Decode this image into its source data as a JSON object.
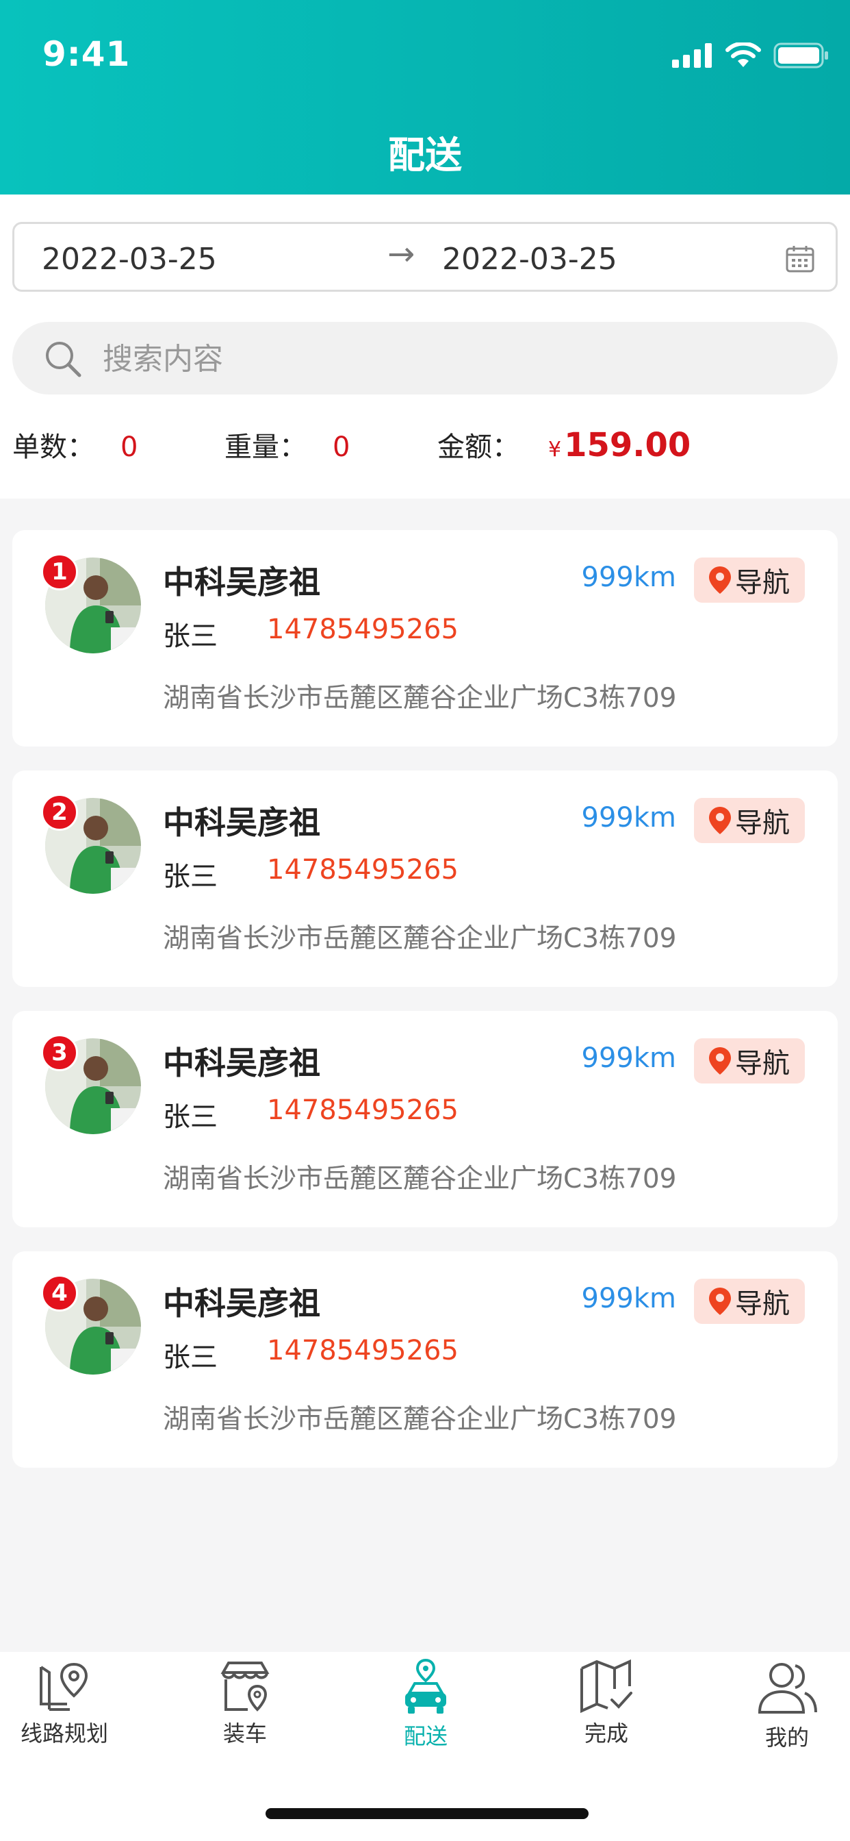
{
  "status_bar": {
    "time": "9:41"
  },
  "header": {
    "title": "配送"
  },
  "filter": {
    "start_date": "2022-03-25",
    "arrow": "→",
    "end_date": "2022-03-25",
    "search_placeholder": "搜索内容"
  },
  "stats": {
    "count_label": "单数：",
    "count_value": "0",
    "weight_label": "重量：",
    "weight_value": "0",
    "amount_label": "金额：",
    "amount_currency": "¥",
    "amount_value": "159.00"
  },
  "orders": [
    {
      "index": "1",
      "name": "中科吴彦祖",
      "distance": "999km",
      "nav_label": "导航",
      "person": "张三",
      "phone": "14785495265",
      "address": "湖南省长沙市岳麓区麓谷企业广场C3栋709"
    },
    {
      "index": "2",
      "name": "中科吴彦祖",
      "distance": "999km",
      "nav_label": "导航",
      "person": "张三",
      "phone": "14785495265",
      "address": "湖南省长沙市岳麓区麓谷企业广场C3栋709"
    },
    {
      "index": "3",
      "name": "中科吴彦祖",
      "distance": "999km",
      "nav_label": "导航",
      "person": "张三",
      "phone": "14785495265",
      "address": "湖南省长沙市岳麓区麓谷企业广场C3栋709"
    },
    {
      "index": "4",
      "name": "中科吴彦祖",
      "distance": "999km",
      "nav_label": "导航",
      "person": "张三",
      "phone": "14785495265",
      "address": "湖南省长沙市岳麓区麓谷企业广场C3栋709"
    }
  ],
  "tabbar": {
    "items": [
      {
        "label": "线路规划",
        "icon": "route-map-icon"
      },
      {
        "label": "装车",
        "icon": "store-location-icon"
      },
      {
        "label": "配送",
        "icon": "delivery-car-icon",
        "active": true
      },
      {
        "label": "完成",
        "icon": "map-check-icon"
      },
      {
        "label": "我的",
        "icon": "users-icon"
      }
    ]
  },
  "colors": {
    "header_gradient_start": "#08c2bd",
    "header_gradient_end": "#04aaa8",
    "accent": "#08b1ad",
    "price_red": "#d4141b",
    "phone_orange": "#ee4420",
    "distance_blue": "#2b8fe6",
    "nav_bg": "#fde1db"
  }
}
